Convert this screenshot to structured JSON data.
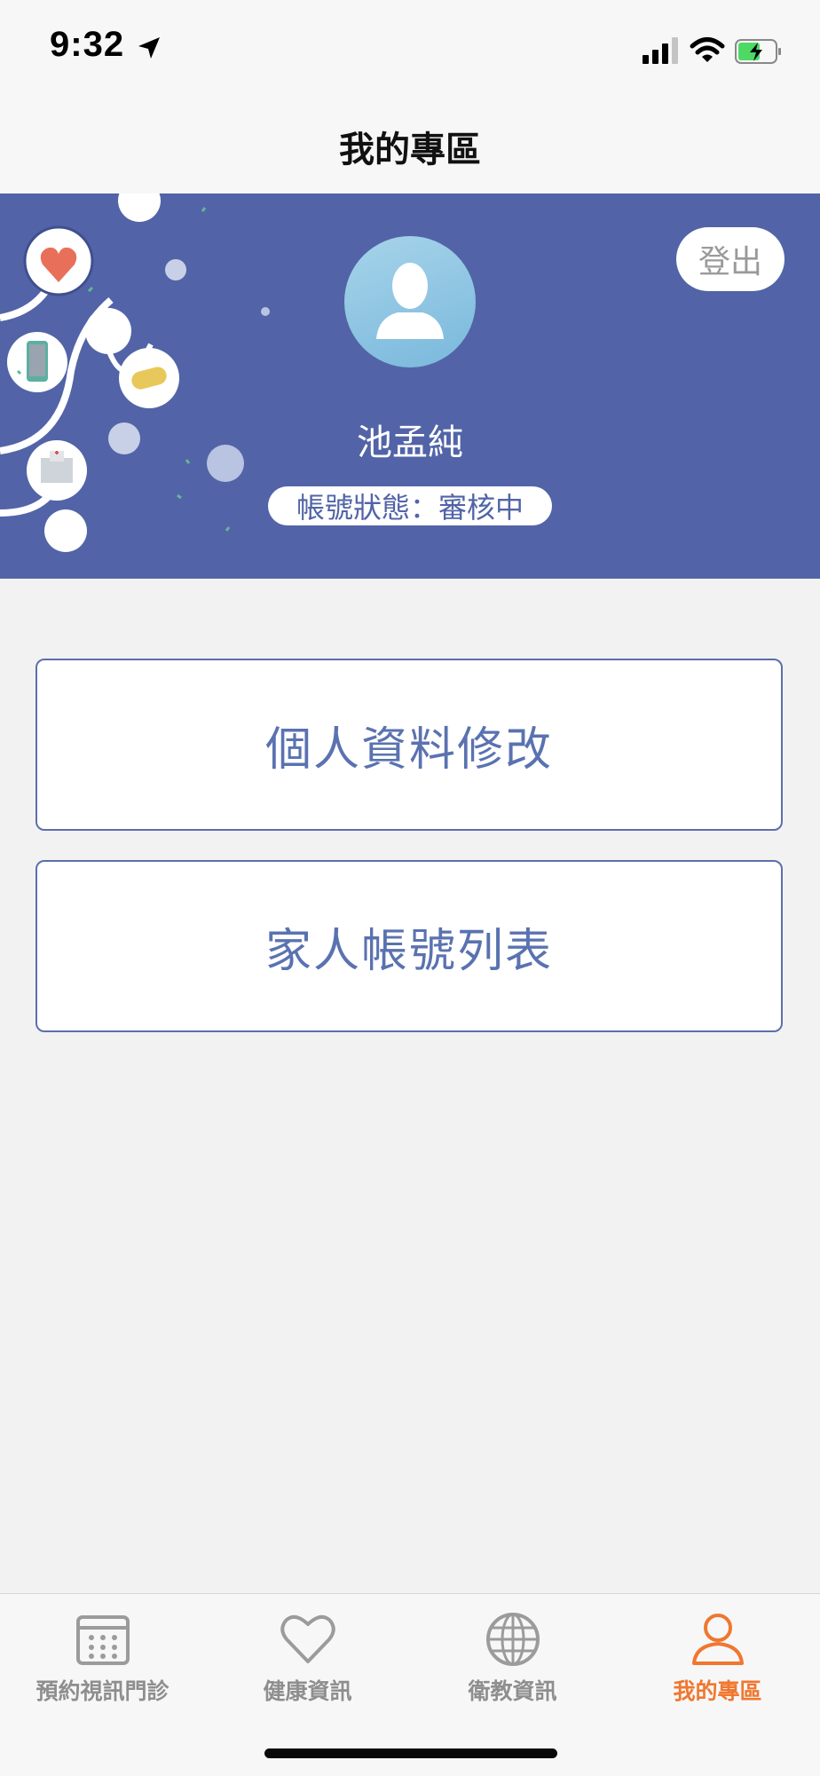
{
  "status_bar": {
    "time": "9:32"
  },
  "nav": {
    "title": "我的專區"
  },
  "profile": {
    "logout_label": "登出",
    "name": "池孟純",
    "account_status": "帳號狀態：審核中"
  },
  "menu": {
    "edit_profile_label": "個人資料修改",
    "family_accounts_label": "家人帳號列表"
  },
  "tabs": [
    {
      "label": "預約視訊門診",
      "icon": "calendar-icon"
    },
    {
      "label": "健康資訊",
      "icon": "heart-icon"
    },
    {
      "label": "衛教資訊",
      "icon": "globe-icon"
    },
    {
      "label": "我的專區",
      "icon": "person-icon"
    }
  ],
  "colors": {
    "header_bg": "#5264a7",
    "accent_text": "#5a72b0",
    "active_tab": "#f0772f",
    "inactive_tab": "#8e8e8e"
  }
}
